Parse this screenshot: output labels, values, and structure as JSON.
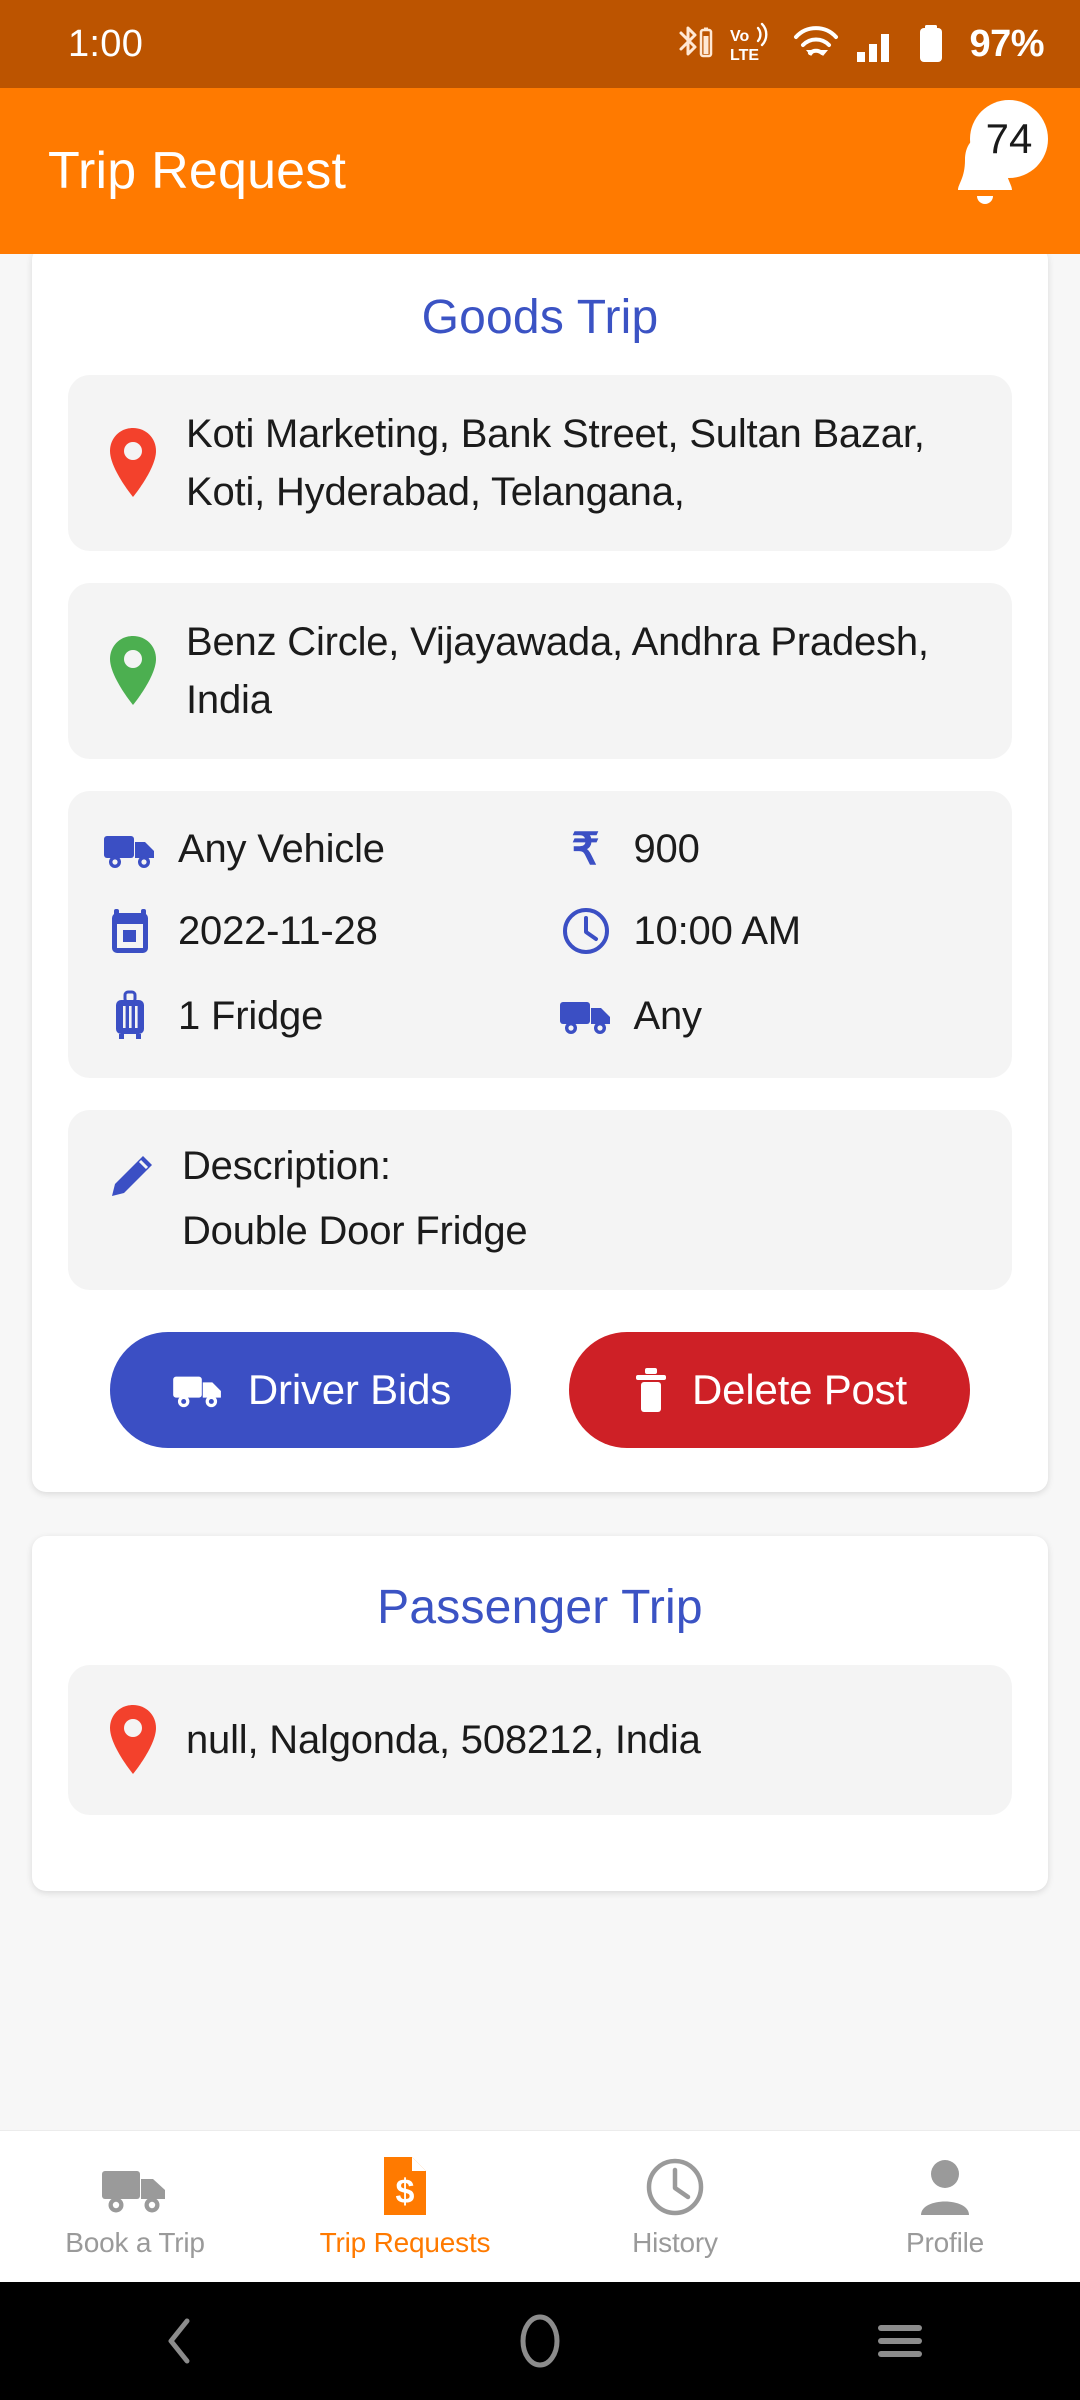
{
  "status_bar": {
    "time": "1:00",
    "battery_percent": "97%",
    "icons": [
      "bluetooth-icon",
      "bluetooth-battery-icon",
      "volte-icon",
      "wifi-icon",
      "signal-icon",
      "battery-icon"
    ]
  },
  "app_bar": {
    "title": "Trip Request",
    "notification_icon": "bell-icon",
    "notification_count": "74"
  },
  "colors": {
    "status_bar": "#BC5400",
    "app_bar": "#FF7A00",
    "accent_blue": "#3B53C4",
    "icon_blue": "#3B4FC4",
    "danger_red": "#CE2026",
    "pickup_pin": "#F3412C",
    "dropoff_pin": "#4CAF50",
    "panel_bg": "#F4F4F4",
    "nav_active": "#FF7A00",
    "nav_inactive": "#9A9A9A"
  },
  "trips": [
    {
      "title": "Goods Trip",
      "pickup": "Koti Marketing, Bank Street, Sultan Bazar, Koti, Hyderabad, Telangana,",
      "dropoff": "Benz Circle, Vijayawada, Andhra Pradesh, India",
      "details": {
        "vehicle": "Any Vehicle",
        "currency_symbol": "₹",
        "price": "900",
        "date": "2022-11-28",
        "time": "10:00 AM",
        "goods": "1 Fridge",
        "vehicle_type": "Any"
      },
      "description_label": "Description:",
      "description_text": "Double Door Fridge",
      "buttons": {
        "bids": "Driver Bids",
        "delete": "Delete Post"
      }
    },
    {
      "title": "Passenger Trip",
      "pickup": "null, Nalgonda, 508212, India"
    }
  ],
  "bottom_nav": [
    {
      "label": "Book a Trip",
      "icon": "truck-icon",
      "active": false
    },
    {
      "label": "Trip Requests",
      "icon": "invoice-icon",
      "active": true
    },
    {
      "label": "History",
      "icon": "clock-icon",
      "active": false
    },
    {
      "label": "Profile",
      "icon": "person-icon",
      "active": false
    }
  ],
  "android_nav": [
    {
      "name": "back-button",
      "icon": "chevron-left-icon"
    },
    {
      "name": "home-button",
      "icon": "circle-icon"
    },
    {
      "name": "recents-button",
      "icon": "menu-icon"
    }
  ]
}
